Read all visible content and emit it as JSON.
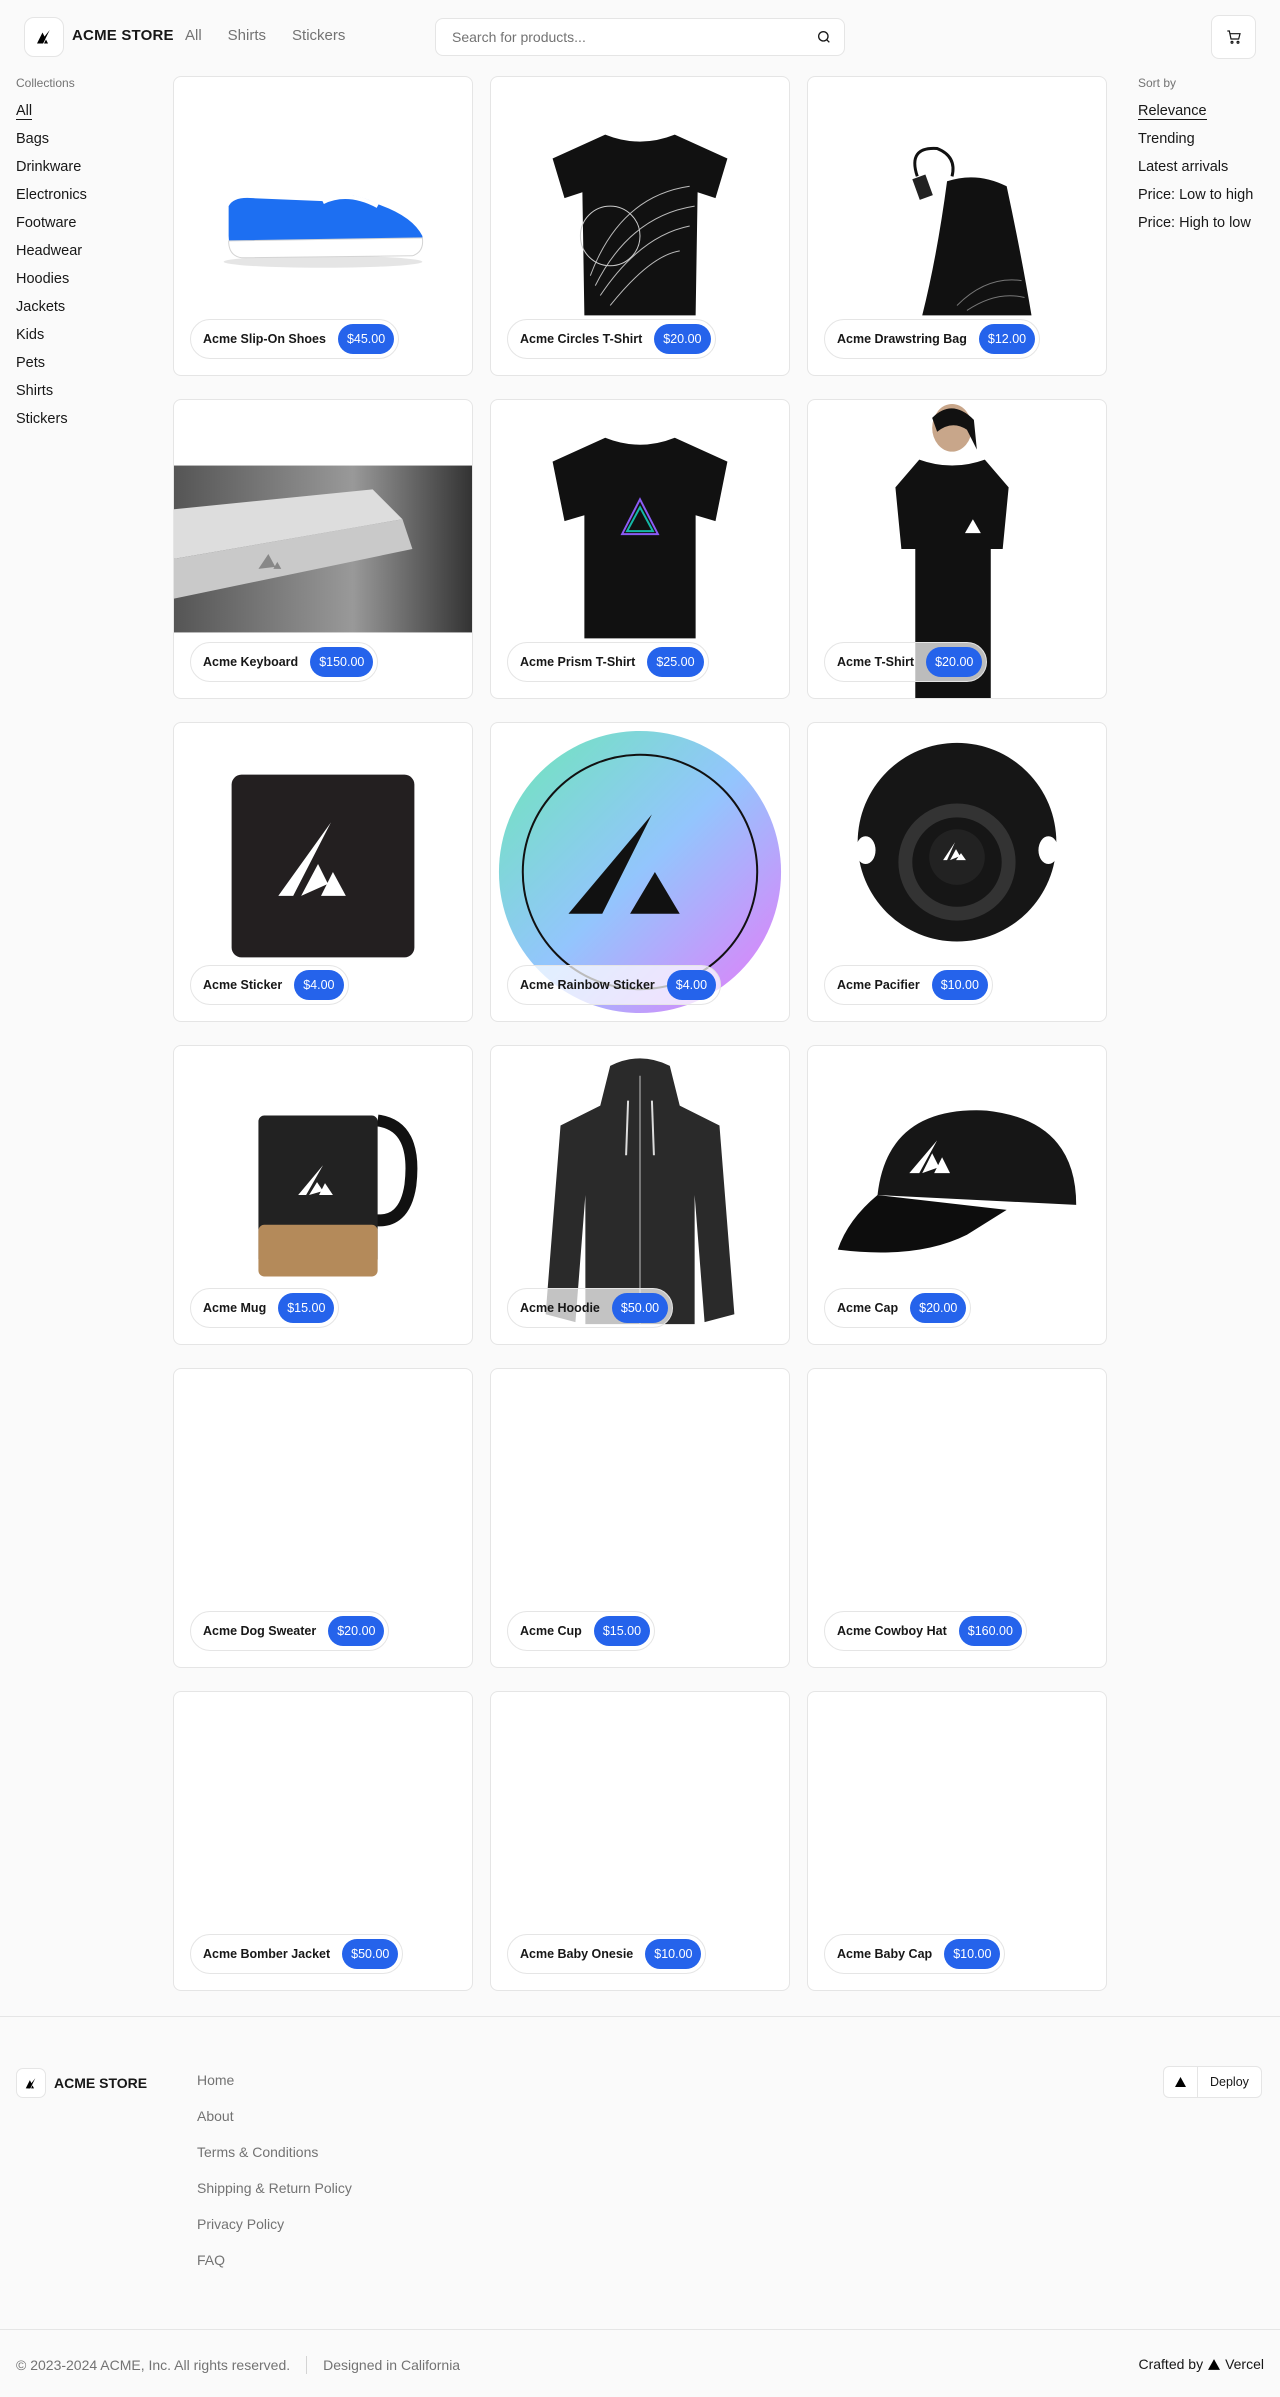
{
  "header": {
    "brand": "ACME STORE",
    "nav": [
      "All",
      "Shirts",
      "Stickers"
    ],
    "search_placeholder": "Search for products...",
    "icons": {
      "logo": "acme-triangle-logo",
      "search": "search-icon",
      "cart": "cart-icon"
    }
  },
  "collections": {
    "title": "Collections",
    "items": [
      "All",
      "Bags",
      "Drinkware",
      "Electronics",
      "Footware",
      "Headwear",
      "Hoodies",
      "Jackets",
      "Kids",
      "Pets",
      "Shirts",
      "Stickers"
    ],
    "active": "All"
  },
  "sort": {
    "title": "Sort by",
    "items": [
      "Relevance",
      "Trending",
      "Latest arrivals",
      "Price: Low to high",
      "Price: High to low"
    ],
    "active": "Relevance"
  },
  "products": [
    {
      "name": "Acme Slip-On Shoes",
      "price": "$45.00",
      "image": "shoe"
    },
    {
      "name": "Acme Circles T-Shirt",
      "price": "$20.00",
      "image": "circles-tshirt"
    },
    {
      "name": "Acme Drawstring Bag",
      "price": "$12.00",
      "image": "drawstring-bag"
    },
    {
      "name": "Acme Keyboard",
      "price": "$150.00",
      "image": "keyboard"
    },
    {
      "name": "Acme Prism T-Shirt",
      "price": "$25.00",
      "image": "prism-tshirt"
    },
    {
      "name": "Acme T-Shirt",
      "price": "$20.00",
      "image": "person-tshirt"
    },
    {
      "name": "Acme Sticker",
      "price": "$4.00",
      "image": "sticker"
    },
    {
      "name": "Acme Rainbow Sticker",
      "price": "$4.00",
      "image": "rainbow-sticker"
    },
    {
      "name": "Acme Pacifier",
      "price": "$10.00",
      "image": "pacifier"
    },
    {
      "name": "Acme Mug",
      "price": "$15.00",
      "image": "mug"
    },
    {
      "name": "Acme Hoodie",
      "price": "$50.00",
      "image": "hoodie"
    },
    {
      "name": "Acme Cap",
      "price": "$20.00",
      "image": "cap"
    },
    {
      "name": "Acme Dog Sweater",
      "price": "$20.00",
      "image": ""
    },
    {
      "name": "Acme Cup",
      "price": "$15.00",
      "image": ""
    },
    {
      "name": "Acme Cowboy Hat",
      "price": "$160.00",
      "image": ""
    },
    {
      "name": "Acme Bomber Jacket",
      "price": "$50.00",
      "image": ""
    },
    {
      "name": "Acme Baby Onesie",
      "price": "$10.00",
      "image": ""
    },
    {
      "name": "Acme Baby Cap",
      "price": "$10.00",
      "image": ""
    }
  ],
  "footer": {
    "brand": "ACME STORE",
    "links": [
      "Home",
      "About",
      "Terms & Conditions",
      "Shipping & Return Policy",
      "Privacy Policy",
      "FAQ"
    ],
    "deploy_label": "Deploy",
    "copyright": "© 2023-2024 ACME, Inc. All rights reserved.",
    "designed": "Designed in California",
    "crafted_prefix": "Crafted by",
    "crafted_brand": "Vercel"
  },
  "colors": {
    "accent": "#2563eb",
    "border": "#e5e5e5",
    "muted": "#737373",
    "background": "#fafafa"
  }
}
